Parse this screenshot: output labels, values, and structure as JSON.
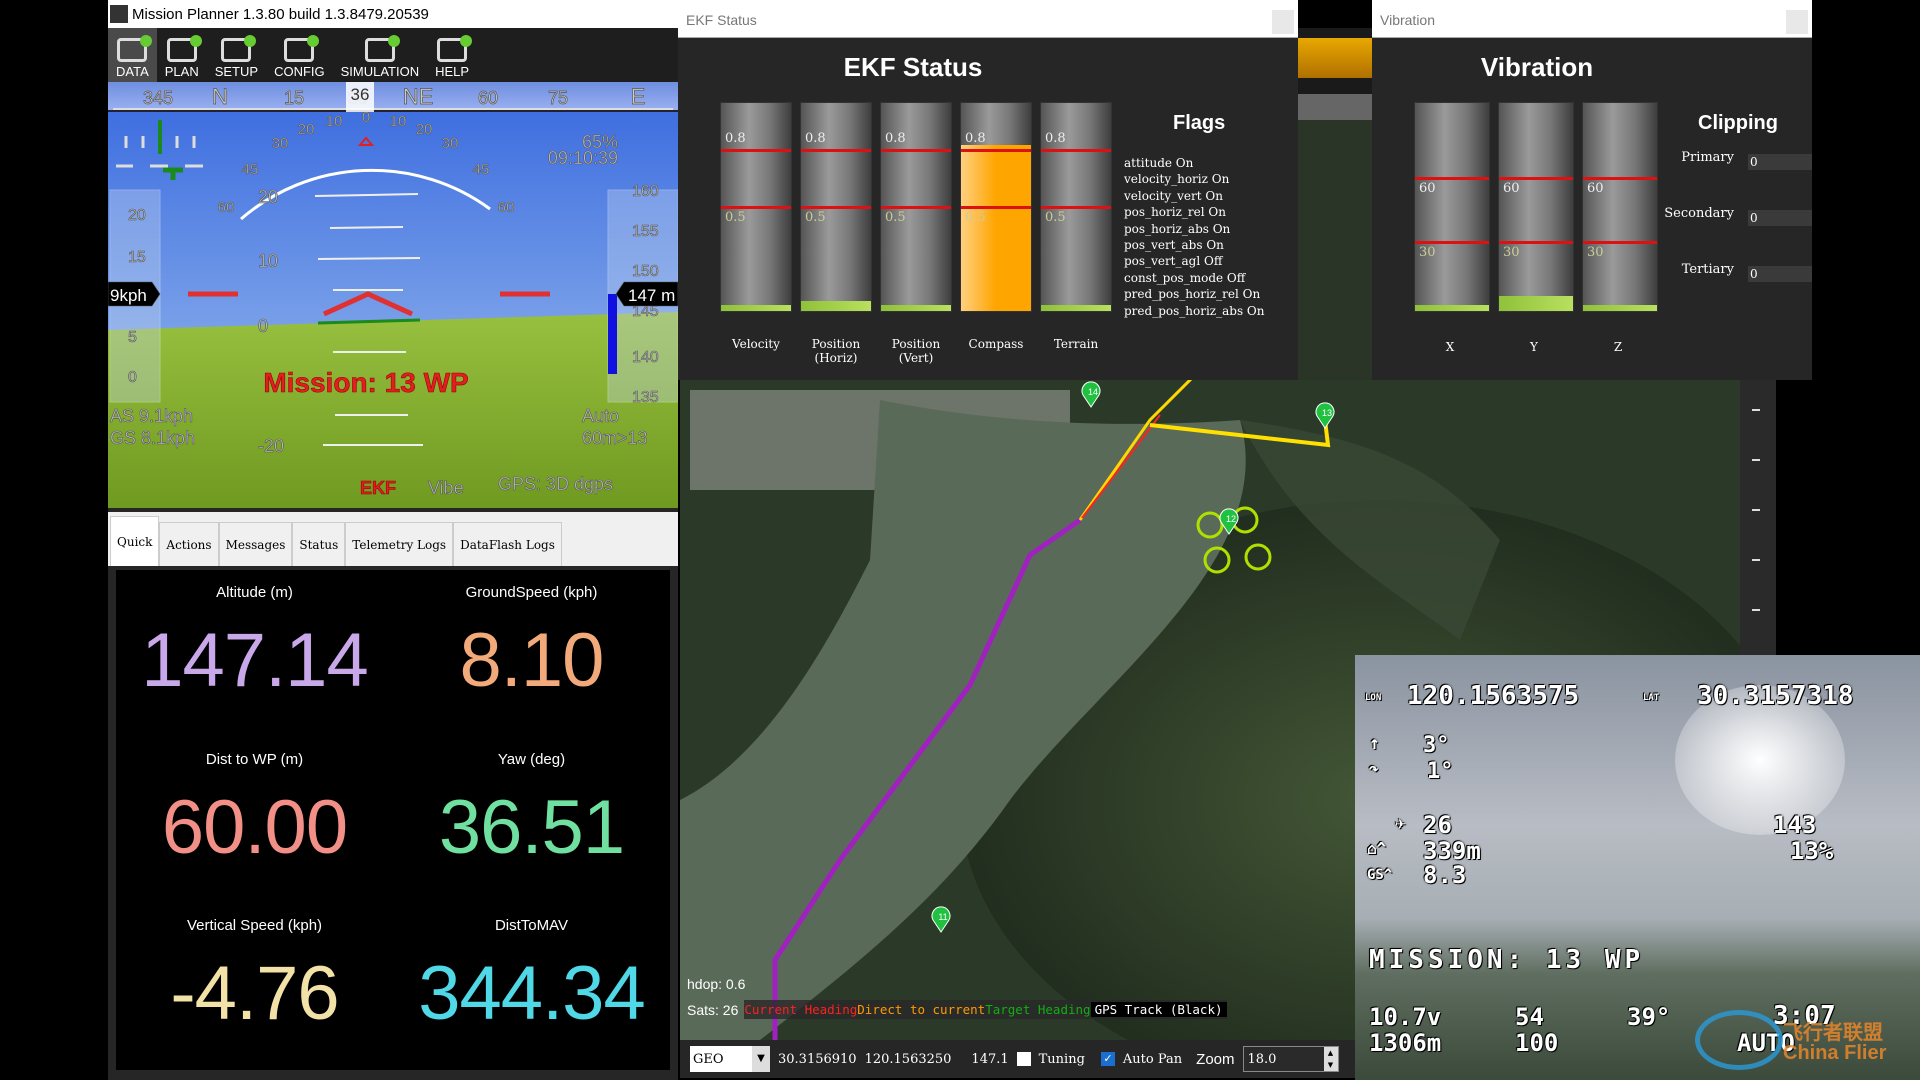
{
  "window": {
    "title": "Mission Planner 1.3.80 build 1.3.8479.20539",
    "logo": "MP"
  },
  "toolbar": [
    {
      "label": "DATA",
      "icon": "data-icon"
    },
    {
      "label": "PLAN",
      "icon": "globe-icon"
    },
    {
      "label": "SETUP",
      "icon": "gear-icon"
    },
    {
      "label": "CONFIG",
      "icon": "wrench-icon"
    },
    {
      "label": "SIMULATION",
      "icon": "monitor-plane-icon"
    },
    {
      "label": "HELP",
      "icon": "help-monitor-icon"
    }
  ],
  "compass": {
    "ticks": [
      "345",
      "N",
      "15",
      "30",
      "NE",
      "60",
      "75",
      "E"
    ],
    "heading": "36"
  },
  "hud": {
    "pitch_ticks": [
      "20",
      "10",
      "0",
      "-20"
    ],
    "roll_ticks": [
      "60",
      "45",
      "30",
      "20",
      "10",
      "0",
      "10",
      "20",
      "30",
      "45",
      "60"
    ],
    "speed_ticks": [
      "20",
      "15",
      "5",
      "0"
    ],
    "speed_box": "9kph",
    "alt_ticks": [
      "160",
      "155",
      "150",
      "145",
      "140",
      "135"
    ],
    "alt_box": "147 m",
    "battery": "65%",
    "time": "09:10:39",
    "message": "Mission: 13 WP",
    "airspeed": "AS 9.1kph",
    "groundspeed": "GS 8.1kph",
    "mode": "Auto",
    "wp": "60m>13",
    "ekf": "EKF",
    "vibe": "Vibe",
    "gps": "GPS: 3D dgps"
  },
  "tabs": [
    "Quick",
    "Actions",
    "Messages",
    "Status",
    "Telemetry Logs",
    "DataFlash Logs"
  ],
  "quick": [
    {
      "label": "Altitude (m)",
      "value": "147.14",
      "color": "#c8a8e8"
    },
    {
      "label": "GroundSpeed (kph)",
      "value": "8.10",
      "color": "#f2aa7a"
    },
    {
      "label": "Dist to WP (m)",
      "value": "60.00",
      "color": "#f29088"
    },
    {
      "label": "Yaw (deg)",
      "value": "36.51",
      "color": "#70e0a0"
    },
    {
      "label": "Vertical Speed (kph)",
      "value": "-4.76",
      "color": "#f2e2a8"
    },
    {
      "label": "DistToMAV",
      "value": "344.34",
      "color": "#50d8e6"
    }
  ],
  "ekf": {
    "window_title": "EKF Status",
    "title": "EKF Status",
    "flags_title": "Flags",
    "bars": [
      {
        "label": "Velocity",
        "value": 0.02
      },
      {
        "label": "Position (Horiz)",
        "value": 0.05
      },
      {
        "label": "Position (Vert)",
        "value": 0
      },
      {
        "label": "Compass",
        "value": 0.8,
        "color": "#ffa500"
      },
      {
        "label": "Terrain",
        "value": 0
      }
    ],
    "thresholds": [
      "0.8",
      "0.5"
    ],
    "flags": [
      "attitude On",
      "velocity_horiz On",
      "velocity_vert On",
      "pos_horiz_rel On",
      "pos_horiz_abs On",
      "pos_vert_abs On",
      "pos_vert_agl Off",
      "const_pos_mode Off",
      "pred_pos_horiz_rel On",
      "pred_pos_horiz_abs On"
    ]
  },
  "vibration": {
    "window_title": "Vibration",
    "title": "Vibration",
    "clipping_title": "Clipping",
    "bars": [
      {
        "label": "X",
        "value": 3
      },
      {
        "label": "Y",
        "value": 7
      },
      {
        "label": "Z",
        "value": 3
      }
    ],
    "thresholds": [
      "60",
      "30"
    ],
    "clipping": [
      {
        "label": "Primary",
        "value": "0"
      },
      {
        "label": "Secondary",
        "value": "0"
      },
      {
        "label": "Tertiary",
        "value": "0"
      }
    ]
  },
  "map": {
    "hdop": "hdop: 0.6",
    "sats": "Sats: 26",
    "legend": [
      {
        "text": "Current Heading",
        "color": "#ff2020"
      },
      {
        "text": "Direct to current",
        "color": "#ff9a00"
      },
      {
        "text": "Target Heading",
        "color": "#10b010"
      },
      {
        "text": "GPS Track (Black)",
        "color": "#ffffff"
      }
    ],
    "waypoints": [
      "11",
      "12",
      "13",
      "14"
    ]
  },
  "statusbar": {
    "coord_system": "GEO",
    "lat": "30.3156910",
    "lng": "120.1563250",
    "alt": "147.1",
    "tuning_label": "Tuning",
    "tuning_checked": false,
    "autopan_label": "Auto Pan",
    "autopan_checked": true,
    "zoom_label": "Zoom",
    "zoom_value": "18.0"
  },
  "fpv": {
    "lon_label": "LON",
    "lon": "120.1563575",
    "lat_label": "LAT",
    "lat": "30.3157318",
    "pitch": "3°",
    "roll": "1°",
    "sats": "26",
    "home_dist": "339m",
    "gs": "8.3",
    "alt": "143",
    "throttle": "13%",
    "mission": "MISSION: 13 WP",
    "voltage": "10.7v",
    "rssi": "54",
    "heading": "39°",
    "flight_time": "3:07",
    "dist": "1306m",
    "lq": "100",
    "mode": "AUTO",
    "watermark": "飞行者联盟 China Flier"
  }
}
